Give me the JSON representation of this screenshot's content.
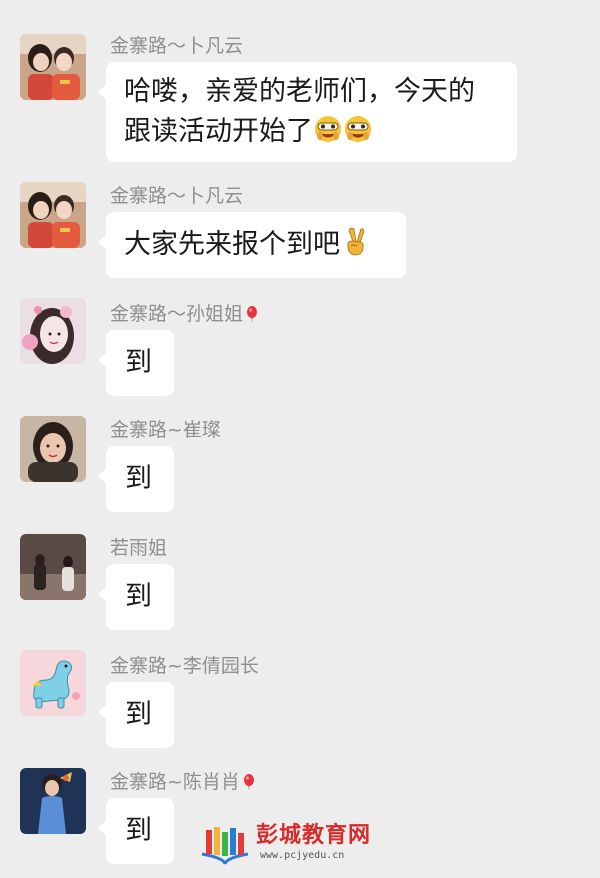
{
  "messages": [
    {
      "sender": "金寨路～卜凡云",
      "lines": [
        "哈喽，亲爱的老师们，今天的",
        "跟读活动开始了"
      ],
      "emoji": "laughing-face-emoji",
      "emoji_count": 2
    },
    {
      "sender": "金寨路～卜凡云",
      "lines": [
        "大家先来报个到吧"
      ],
      "emoji": "victory-hand-emoji",
      "emoji_count": 1
    },
    {
      "sender": "金寨路～孙姐姐",
      "sender_emoji": "balloon-emoji",
      "lines": [
        "到"
      ]
    },
    {
      "sender": "金寨路~崔璨",
      "lines": [
        "到"
      ]
    },
    {
      "sender": "若雨姐",
      "lines": [
        "到"
      ]
    },
    {
      "sender": "金寨路~李倩园长",
      "lines": [
        "到"
      ]
    },
    {
      "sender": "金寨路~陈肖肖",
      "sender_emoji": "balloon-emoji",
      "lines": [
        "到"
      ]
    }
  ],
  "watermark": {
    "title": "彭城教育网",
    "url": "www.pcjyedu.cn"
  },
  "colors": {
    "background": "#ededed",
    "bubble": "#ffffff",
    "sender_text": "#8f8f8f",
    "watermark_red": "#d82b2b"
  }
}
